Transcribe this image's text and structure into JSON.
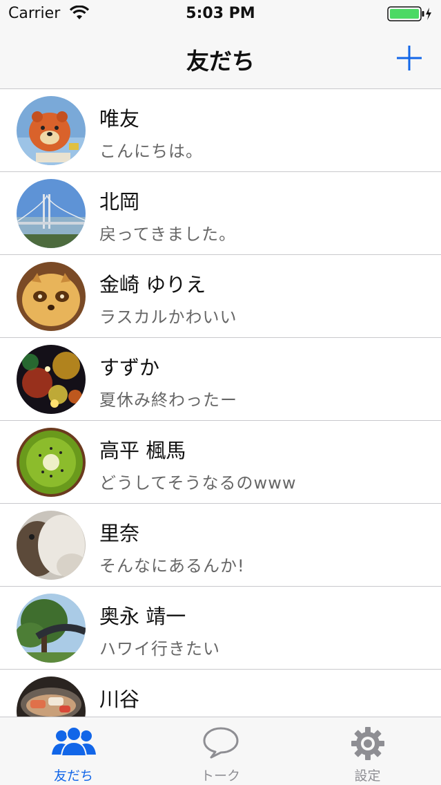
{
  "status": {
    "carrier": "Carrier",
    "time": "5:03 PM"
  },
  "nav": {
    "title": "友だち",
    "add_icon": "plus-icon"
  },
  "friends": [
    {
      "name": "唯友",
      "message": "こんにちは。",
      "avatar": "bear-balloon-photo"
    },
    {
      "name": "北岡",
      "message": "戻ってきました。",
      "avatar": "bridge-photo"
    },
    {
      "name": "金崎 ゆりえ",
      "message": "ラスカルかわいい",
      "avatar": "raccoon-cookie-photo"
    },
    {
      "name": "すずか",
      "message": "夏休み終わったー",
      "avatar": "fireworks-photo"
    },
    {
      "name": "高平 楓馬",
      "message": "どうしてそうなるのwww",
      "avatar": "kiwi-photo"
    },
    {
      "name": "里奈",
      "message": "そんなにあるんか!",
      "avatar": "cat-photo"
    },
    {
      "name": "奥永 靖一",
      "message": "ハワイ行きたい",
      "avatar": "tree-gate-photo"
    },
    {
      "name": "川谷",
      "message": "",
      "avatar": "sushi-photo"
    }
  ],
  "tabs": [
    {
      "label": "友だち",
      "icon": "people-icon",
      "active": true
    },
    {
      "label": "トーク",
      "icon": "speech-bubble-icon",
      "active": false
    },
    {
      "label": "設定",
      "icon": "gear-icon",
      "active": false
    }
  ],
  "colors": {
    "accent": "#1266e8",
    "battery": "#4cd964",
    "inactive": "#8e8e93"
  }
}
